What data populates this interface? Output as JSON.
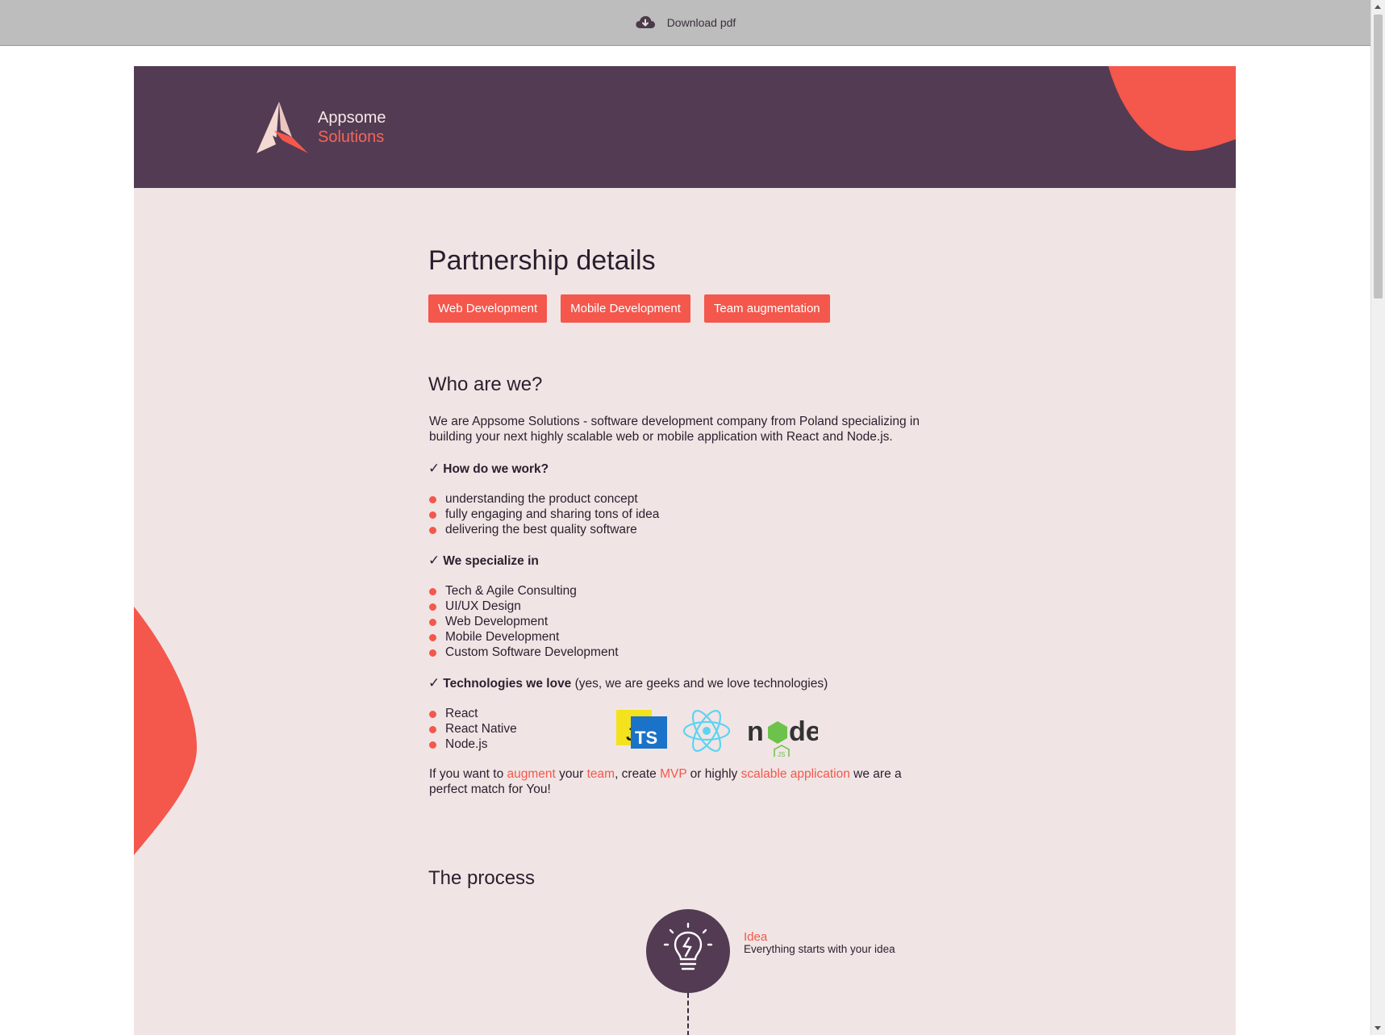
{
  "toolbar": {
    "download_label": "Download pdf",
    "download_icon": "cloud-download-icon"
  },
  "header": {
    "brand_name": "Appsome",
    "brand_sub": "Solutions"
  },
  "main": {
    "title": "Partnership details",
    "tags": [
      "Web Development",
      "Mobile Development",
      "Team augmentation"
    ],
    "who": {
      "heading": "Who are we?",
      "intro": "We are Appsome Solutions - software development company from Poland specializing in building your next highly scalable web or mobile application with React and Node.js.",
      "how_heading": "How do we work?",
      "how_items": [
        "understanding the product concept",
        "fully engaging and sharing tons of idea",
        "delivering the best quality software"
      ],
      "spec_heading": "We specialize in",
      "spec_items": [
        "Tech & Agile Consulting",
        "UI/UX Design",
        "Web Development",
        "Mobile Development",
        "Custom Software Development"
      ],
      "tech_heading": "Technologies we love",
      "tech_note": "(yes, we are geeks and we love technologies)",
      "tech_items": [
        "React",
        "React Native",
        "Node.js"
      ],
      "tech_logos": [
        "js-ts-logo",
        "react-logo",
        "nodejs-logo"
      ],
      "closing": {
        "p1": "If you want to ",
        "h1": "augment",
        "p2": " your ",
        "h2": "team",
        "p3": ", create ",
        "h3": "MVP",
        "p4": " or highly ",
        "h4": "scalable application",
        "p5": " we are a perfect match for You!"
      }
    },
    "process": {
      "heading": "The process",
      "steps": [
        {
          "title": "Idea",
          "desc": "Everything starts with your idea",
          "icon": "lightbulb-icon"
        }
      ]
    }
  },
  "colors": {
    "accent": "#f4574c",
    "header_bg": "#533b53",
    "page_bg": "#f0e5e4",
    "toolbar_bg": "#bdbdbd"
  }
}
